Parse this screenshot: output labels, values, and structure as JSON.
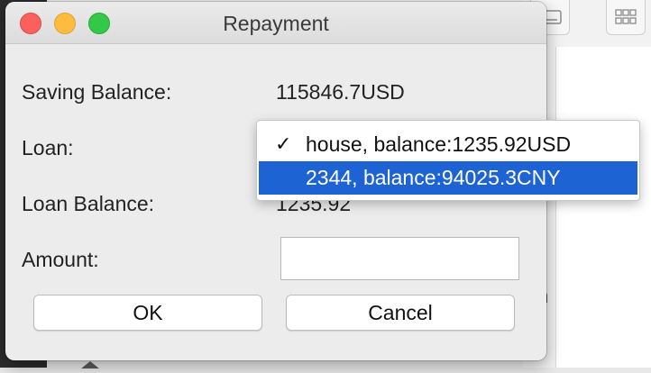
{
  "dialog": {
    "title": "Repayment",
    "fields": {
      "saving_balance_label": "Saving Balance:",
      "saving_balance_value": "115846.7USD",
      "loan_label": "Loan:",
      "loan_balance_label": "Loan Balance:",
      "loan_balance_value": "1235.92",
      "amount_label": "Amount:",
      "amount_value": ""
    },
    "loan_dropdown": {
      "selected_index": 0,
      "highlighted_index": 1,
      "options": [
        {
          "label": "house, balance:1235.92USD",
          "checked": true
        },
        {
          "label": "2344, balance:94025.3CNY",
          "checked": false
        }
      ]
    },
    "buttons": {
      "ok": "OK",
      "cancel": "Cancel"
    }
  },
  "background": {
    "partial_letter": "n"
  },
  "colors": {
    "highlight": "#1e63d3",
    "close": "#fc605c",
    "minimize": "#fdbc40",
    "maximize": "#34c84a"
  }
}
